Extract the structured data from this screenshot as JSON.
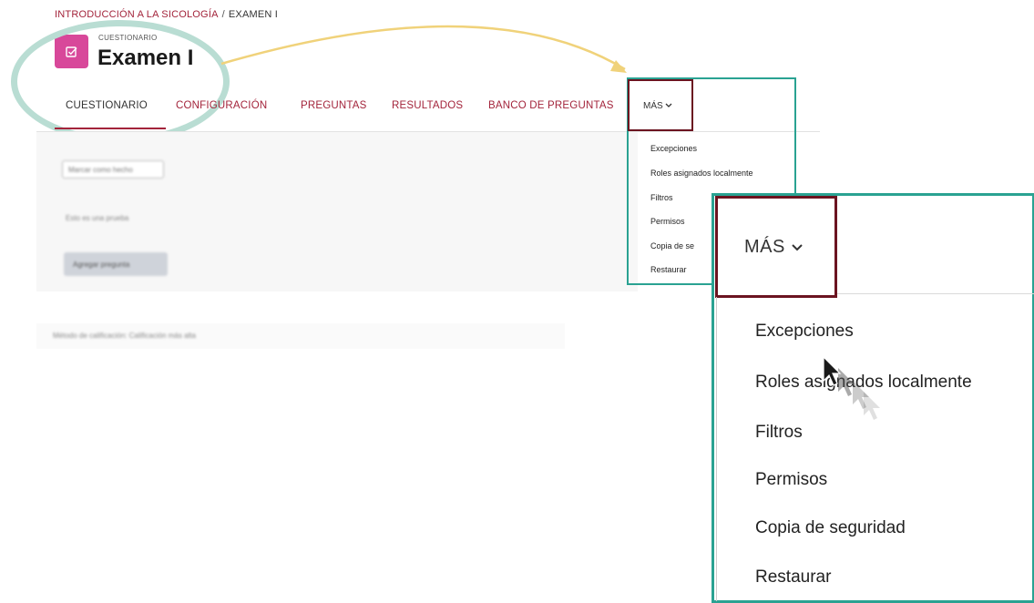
{
  "breadcrumb": {
    "course": "INTRODUCCIÓN A LA SICOLOGÍA",
    "separator": "/",
    "current": "EXAMEN I"
  },
  "activity": {
    "type_label": "CUESTIONARIO",
    "title": "Examen I",
    "icon": "checkbox-edit-icon",
    "icon_color": "#d8489a"
  },
  "tabs": [
    {
      "label": "CUESTIONARIO",
      "active": true
    },
    {
      "label": "CONFIGURACIÓN",
      "active": false
    },
    {
      "label": "PREGUNTAS",
      "active": false
    },
    {
      "label": "RESULTADOS",
      "active": false
    },
    {
      "label": "BANCO DE PREGUNTAS",
      "active": false
    },
    {
      "label": "MÁS",
      "active": false,
      "icon": "chevron-down-icon"
    }
  ],
  "content": {
    "mark_done_label": "Marcar como hecho",
    "description": "Esto es una prueba",
    "add_question_label": "Agregar pregunta",
    "grading_method": "Método de calificación: Calificación más alta"
  },
  "more_menu_small": {
    "label": "MÁS",
    "items": [
      "Excepciones",
      "Roles asignados localmente",
      "Filtros",
      "Permisos",
      "Copia de se",
      "Restaurar"
    ]
  },
  "more_menu_callout": {
    "label": "MÁS",
    "items": [
      "Excepciones",
      "Roles asignados localmente",
      "Filtros",
      "Permisos",
      "Copia de seguridad",
      "Restaurar"
    ]
  },
  "colors": {
    "brand": "#a3243b",
    "highlight_frame": "#2aa292",
    "highlight_circle": "#b9ddd3",
    "selected_frame": "#6b1420",
    "arrow": "#f0d27a"
  }
}
